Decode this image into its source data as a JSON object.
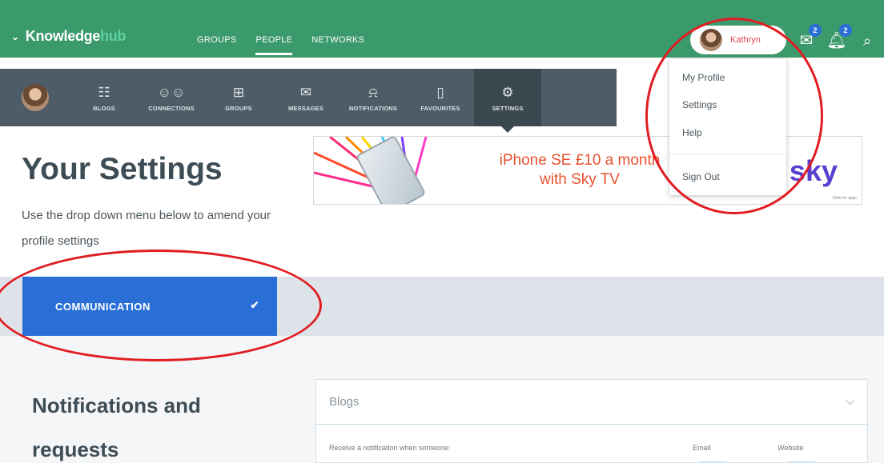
{
  "topbar": {
    "brand_prefix": "Knowledge",
    "brand_suffix": "hub",
    "nav": [
      "GROUPS",
      "PEOPLE",
      "NETWORKS"
    ],
    "active_nav": "PEOPLE",
    "user_name": "Kathryn",
    "messages_badge": "2",
    "notifications_badge": "2"
  },
  "subnav": {
    "items": [
      {
        "label": "BLOGS",
        "icon": "blogs-icon"
      },
      {
        "label": "CONNECTIONS",
        "icon": "connections-icon"
      },
      {
        "label": "GROUPS",
        "icon": "groups-icon"
      },
      {
        "label": "MESSAGES",
        "icon": "envelope-icon"
      },
      {
        "label": "NOTIFICATIONS",
        "icon": "bell-icon"
      },
      {
        "label": "FAVOURITES",
        "icon": "bookmark-icon"
      },
      {
        "label": "SETTINGS",
        "icon": "gear-icon"
      }
    ]
  },
  "user_menu": {
    "items": [
      "My Profile",
      "Settings",
      "Help"
    ],
    "sign_out": "Sign Out"
  },
  "ad": {
    "line1": "iPhone SE £10 a month",
    "line2": "with Sky TV",
    "logo": "sky",
    "small": "Click for apps"
  },
  "page": {
    "title": "Your Settings",
    "description": "Use the drop down menu below to amend your profile settings"
  },
  "settings_select": {
    "value": "COMMUNICATION"
  },
  "notifications": {
    "title": "Notifications and requests",
    "card_title": "Blogs",
    "row_label": "Receive a notification when someone:",
    "col_email": "Email",
    "col_website": "Website"
  },
  "colors": {
    "brand_green": "#3b9a6c",
    "subnav_grey": "#4d5c66",
    "accent_blue": "#2a6fd6",
    "annotation_red": "#e11d22"
  }
}
